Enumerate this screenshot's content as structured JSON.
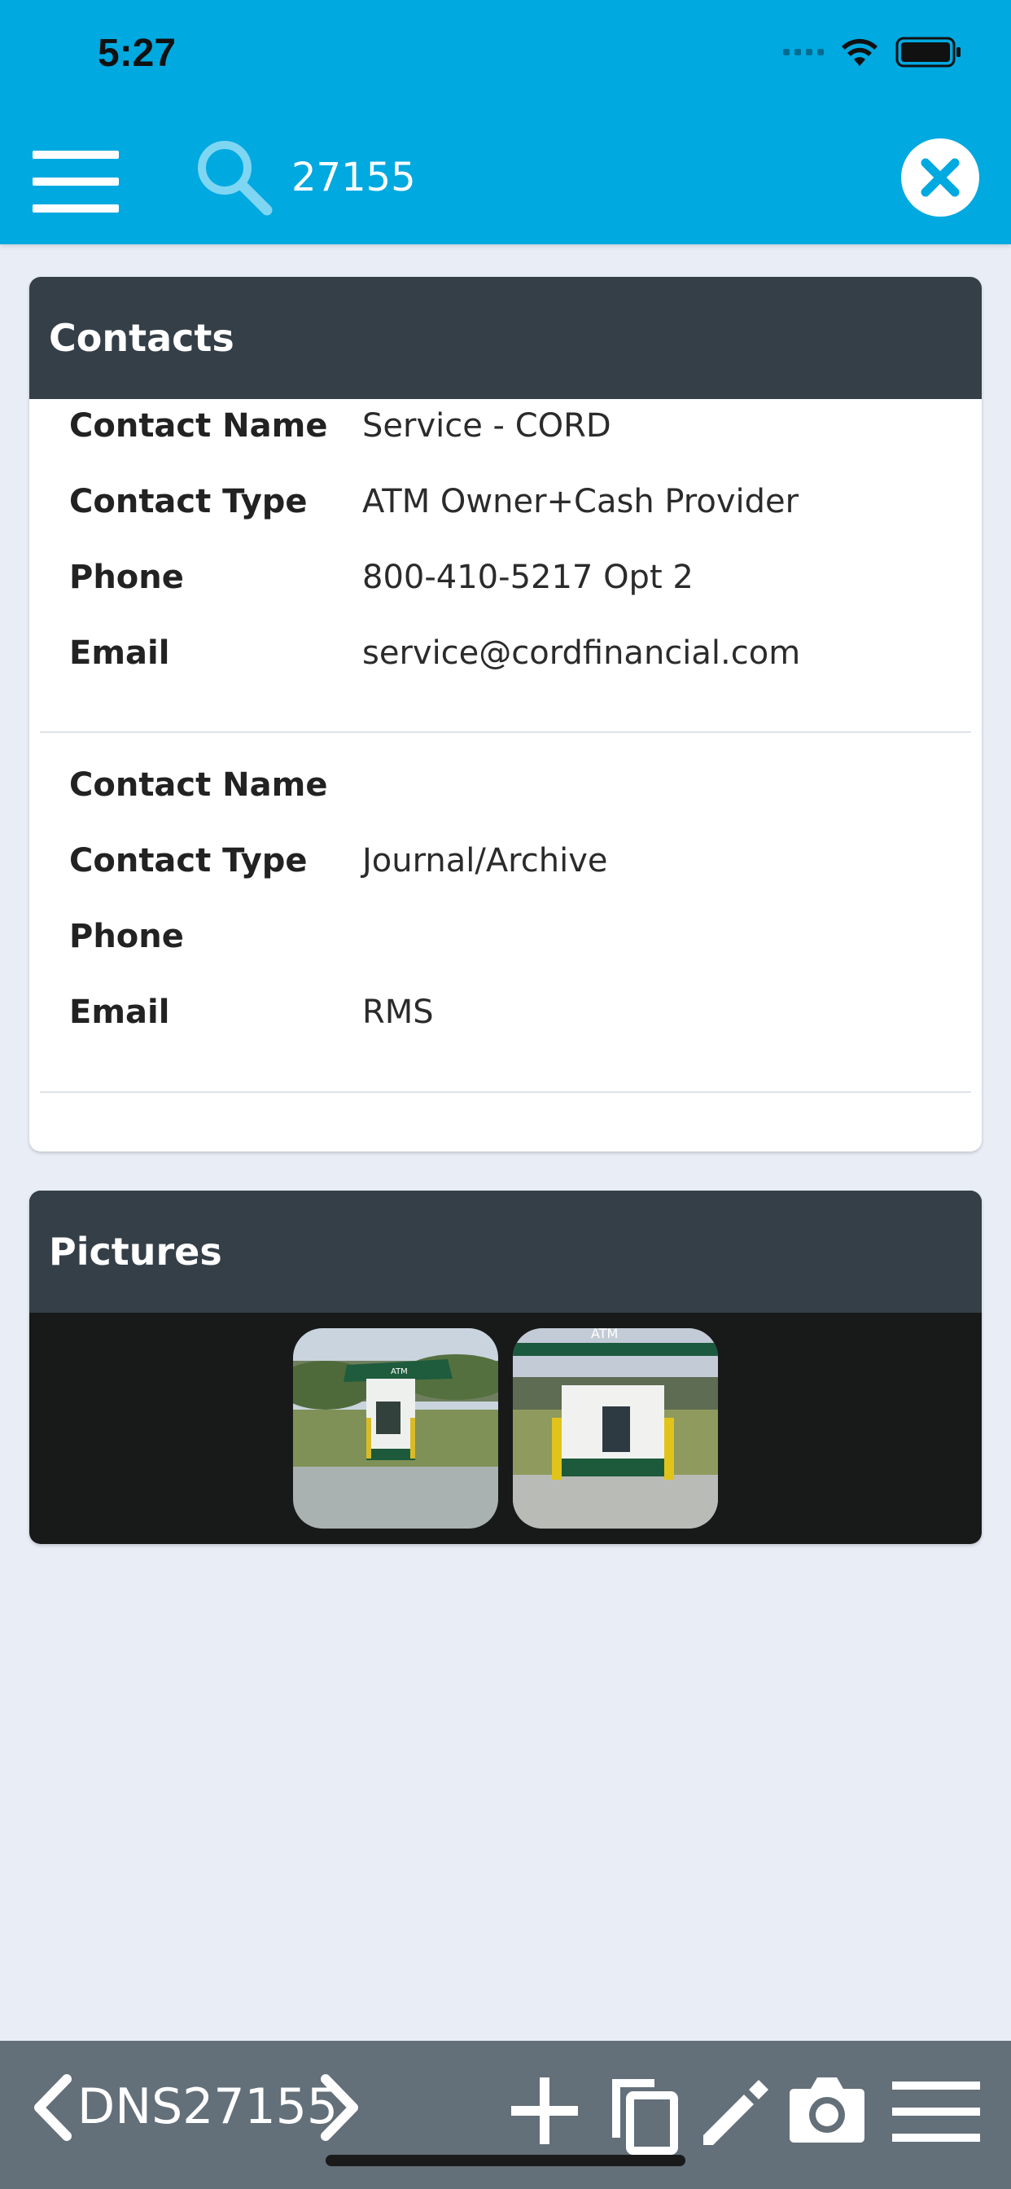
{
  "status_bar": {
    "time": "5:27"
  },
  "search": {
    "value": "27155"
  },
  "contacts": {
    "title": "Contacts",
    "entries": [
      {
        "name_label": "Contact Name",
        "name_value": "Service - CORD",
        "type_label": "Contact Type",
        "type_value": "ATM Owner+Cash Provider",
        "phone_label": "Phone",
        "phone_value": "800-410-5217 Opt 2",
        "email_label": "Email",
        "email_value": "service@cordfinancial.com"
      },
      {
        "name_label": "Contact Name",
        "name_value": "",
        "type_label": "Contact Type",
        "type_value": "Journal/Archive",
        "phone_label": "Phone",
        "phone_value": "",
        "email_label": "Email",
        "email_value": "RMS"
      }
    ]
  },
  "pictures": {
    "title": "Pictures",
    "photo_sign_text": "ATM"
  },
  "bottom_bar": {
    "record_label": "DNS27155",
    "icons": [
      "chevron-left-icon",
      "chevron-right-icon",
      "plus-icon",
      "copy-icon",
      "pencil-icon",
      "camera-icon",
      "menu-icon"
    ]
  },
  "colors": {
    "header": "#00a9e0",
    "card_header": "#353f47",
    "bottom_bar": "#636f79",
    "background": "#e9eef6"
  }
}
